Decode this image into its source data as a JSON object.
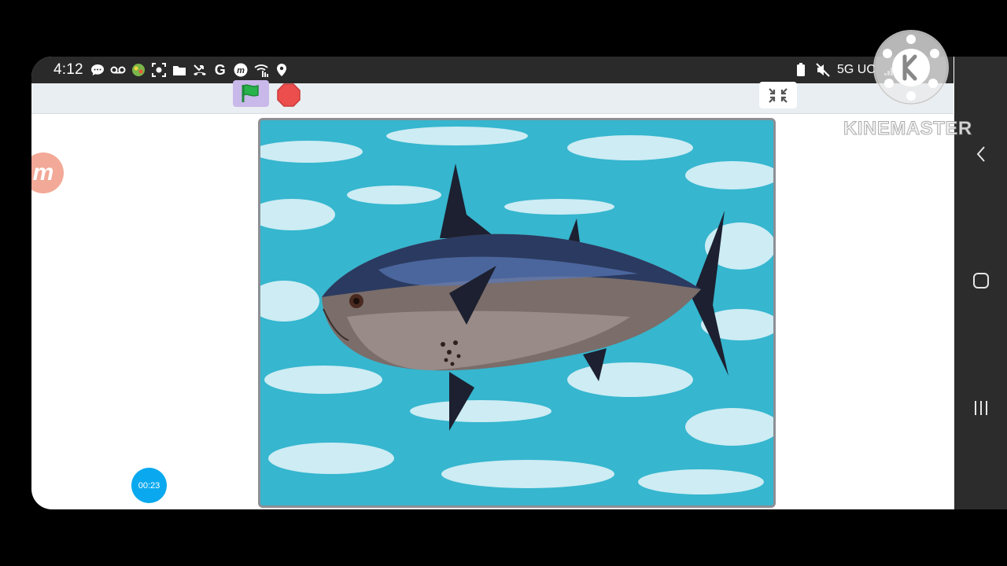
{
  "status_bar": {
    "time": "4:12",
    "left_icons": [
      "message-icon",
      "voicemail-icon",
      "app-icon",
      "screen-record-icon",
      "folder-icon",
      "missed-call-icon",
      "google-icon",
      "m-app-icon",
      "wifi-calling-icon",
      "location-icon"
    ],
    "network": "5G UC",
    "battery": "5%"
  },
  "toolbar": {
    "flag_color": "#27b24a",
    "stop_color": "#ec4d4d",
    "accent": "#c9b8ea"
  },
  "stage": {
    "background_color": "#36b6cf",
    "sprite": "tuna-fish"
  },
  "timer": {
    "label": "00:23"
  },
  "watermark": {
    "brand_text": "KINEMASTER"
  },
  "nav_bar": {
    "buttons": [
      "back-icon",
      "home-icon",
      "recents-icon"
    ]
  }
}
